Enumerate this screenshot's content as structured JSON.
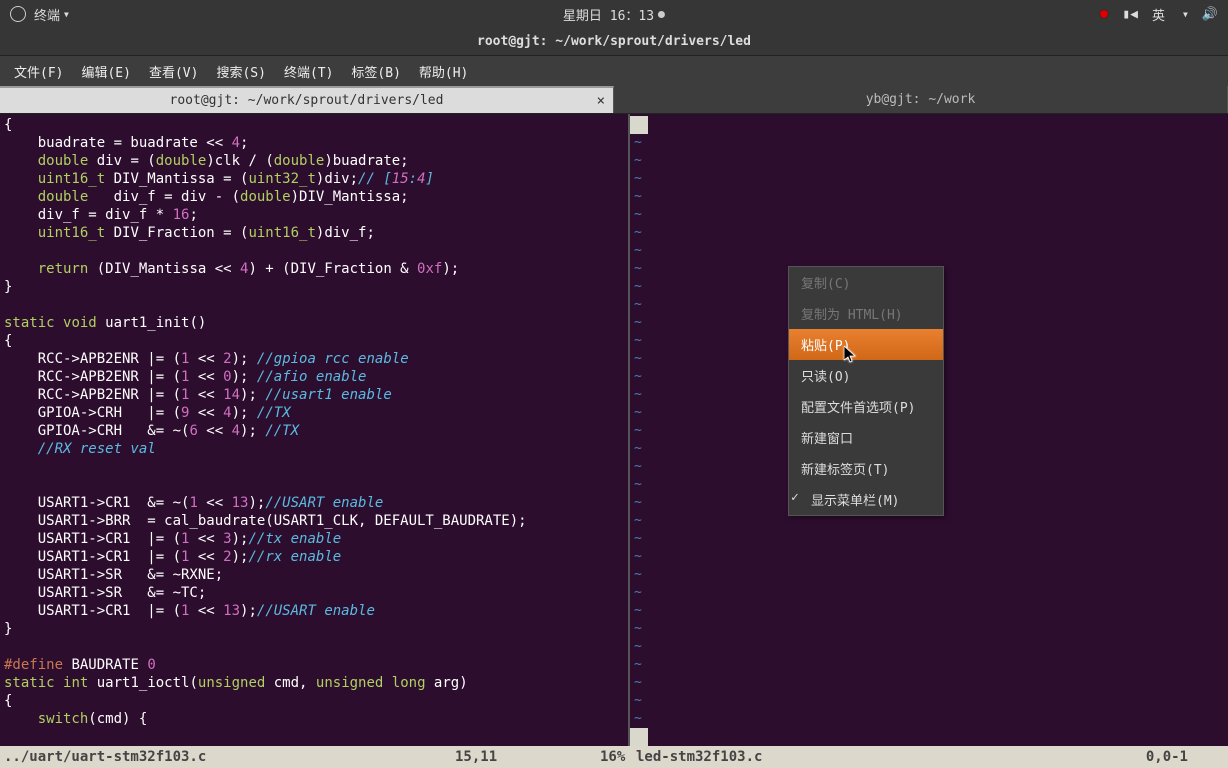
{
  "topbar": {
    "app_name": "终端",
    "datetime": "星期日 16：13",
    "ime": "英"
  },
  "window": {
    "title": "root@gjt: ~/work/sprout/drivers/led"
  },
  "menubar": [
    "文件(F)",
    "编辑(E)",
    "查看(V)",
    "搜索(S)",
    "终端(T)",
    "标签(B)",
    "帮助(H)"
  ],
  "tabs": [
    {
      "title": "root@gjt: ~/work/sprout/drivers/led",
      "active": true
    },
    {
      "title": "yb@gjt: ~/work",
      "active": false
    }
  ],
  "code": {
    "lines": [
      {
        "t": "{"
      },
      {
        "t": "    buadrate = buadrate << 4;"
      },
      {
        "t": "    double div = (double)clk / (double)buadrate;"
      },
      {
        "t": "    uint16_t DIV_Mantissa = (uint32_t)div;// [15:4]"
      },
      {
        "t": "    double   div_f = div - (double)DIV_Mantissa;"
      },
      {
        "t": "    div_f = div_f * 16;"
      },
      {
        "t": "    uint16_t DIV_Fraction = (uint16_t)div_f;"
      },
      {
        "t": ""
      },
      {
        "t": "    return (DIV_Mantissa << 4) + (DIV_Fraction & 0xf);"
      },
      {
        "t": "}"
      },
      {
        "t": ""
      },
      {
        "t": "static void uart1_init()"
      },
      {
        "t": "{"
      },
      {
        "t": "    RCC->APB2ENR |= (1 << 2); //gpioa rcc enable"
      },
      {
        "t": "    RCC->APB2ENR |= (1 << 0); //afio enable"
      },
      {
        "t": "    RCC->APB2ENR |= (1 << 14); //usart1 enable"
      },
      {
        "t": "    GPIOA->CRH   |= (9 << 4); //TX"
      },
      {
        "t": "    GPIOA->CRH   &= ~(6 << 4); //TX"
      },
      {
        "t": "    //RX reset val"
      },
      {
        "t": ""
      },
      {
        "t": ""
      },
      {
        "t": "    USART1->CR1  &= ~(1 << 13);//USART enable"
      },
      {
        "t": "    USART1->BRR  = cal_baudrate(USART1_CLK, DEFAULT_BAUDRATE);"
      },
      {
        "t": "    USART1->CR1  |= (1 << 3);//tx enable"
      },
      {
        "t": "    USART1->CR1  |= (1 << 2);//rx enable"
      },
      {
        "t": "    USART1->SR   &= ~RXNE;"
      },
      {
        "t": "    USART1->SR   &= ~TC;"
      },
      {
        "t": "    USART1->CR1  |= (1 << 13);//USART enable"
      },
      {
        "t": "}"
      },
      {
        "t": ""
      },
      {
        "t": "#define BAUDRATE 0"
      },
      {
        "t": "static int uart1_ioctl(unsigned cmd, unsigned long arg)"
      },
      {
        "t": "{"
      },
      {
        "t": "    switch(cmd) {"
      }
    ]
  },
  "statusbar": {
    "left_file": "../uart/uart-stm32f103.c",
    "left_pos": "15,11",
    "left_pct": "16%",
    "right_file": "led-stm32f103.c",
    "right_pos": "0,0-1"
  },
  "context_menu": [
    {
      "label": "复制(C)",
      "enabled": false
    },
    {
      "label": "复制为 HTML(H)",
      "enabled": false
    },
    {
      "label": "粘贴(P)",
      "enabled": true,
      "highlighted": true
    },
    {
      "label": "只读(O)",
      "enabled": true
    },
    {
      "label": "配置文件首选项(P)",
      "enabled": true
    },
    {
      "label": "新建窗口",
      "enabled": true
    },
    {
      "label": "新建标签页(T)",
      "enabled": true
    },
    {
      "label": "显示菜单栏(M)",
      "enabled": true,
      "checked": true
    }
  ]
}
